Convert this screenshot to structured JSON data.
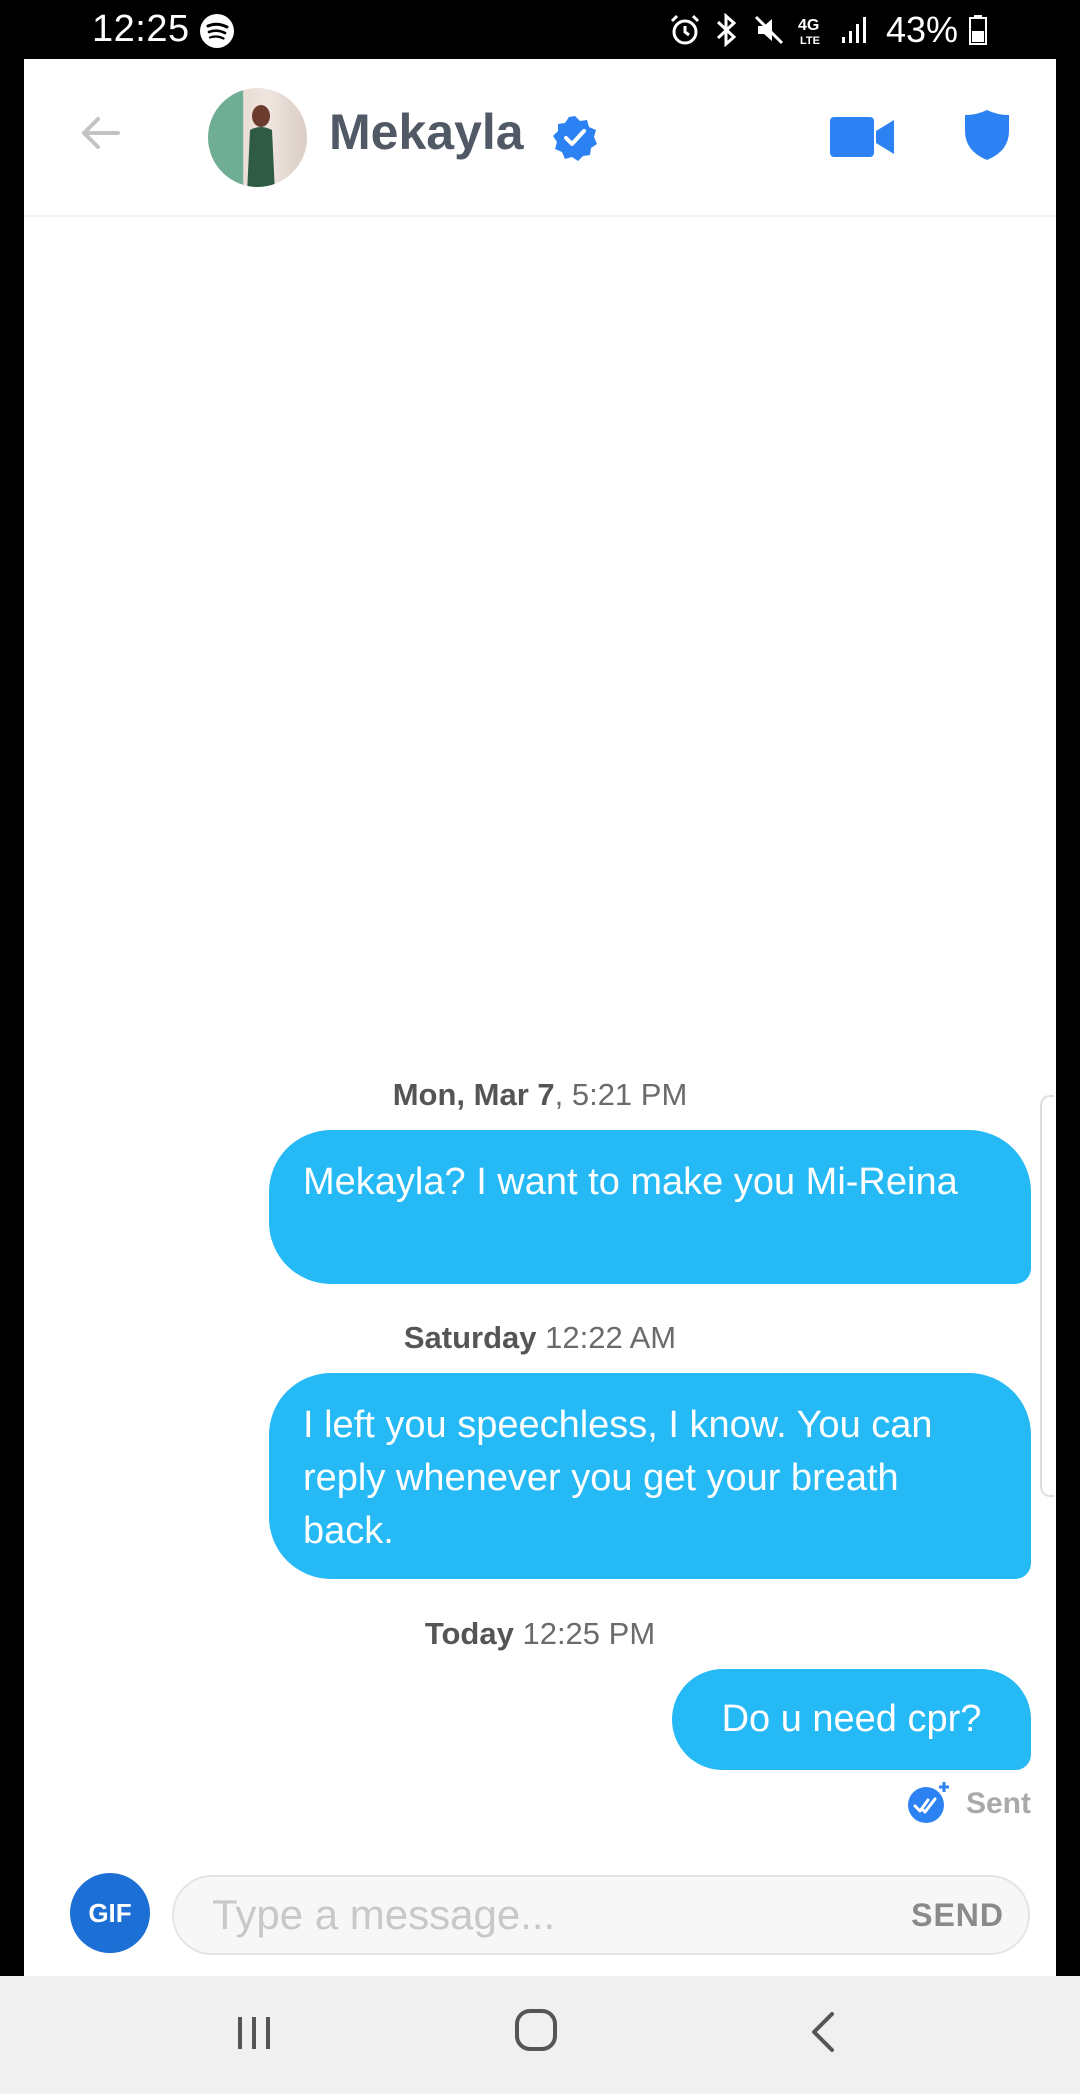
{
  "status_bar": {
    "time": "12:25",
    "network": "4G LTE",
    "battery_percent": "43%"
  },
  "header": {
    "contact_name": "Mekayla",
    "accent_color": "#2c82f2"
  },
  "conversation": {
    "groups": [
      {
        "date_bold": "Mon, Mar 7",
        "date_rest": ", 5:21 PM",
        "message": "Mekayla? I want to make you Mi-Reina"
      },
      {
        "date_bold": "Saturday",
        "date_rest": " 12:22 AM",
        "message": "I left you speechless, I know. You can reply whenever you get your breath back."
      },
      {
        "date_bold": "Today",
        "date_rest": " 12:25 PM",
        "message": "Do u need cpr?"
      }
    ],
    "delivery_status": "Sent",
    "bubble_color": "#25b9f5"
  },
  "composer": {
    "gif_label": "GIF",
    "placeholder": "Type a message...",
    "send_label": "SEND"
  },
  "icons": {
    "back": "back-arrow-icon",
    "verified": "verified-badge-icon",
    "video": "video-camera-icon",
    "safety": "shield-icon",
    "status": [
      "spotify-icon",
      "alarm-icon",
      "bluetooth-icon",
      "mute-icon",
      "signal-icon",
      "battery-icon"
    ],
    "nav": [
      "recents-icon",
      "home-icon",
      "nav-back-icon"
    ]
  }
}
